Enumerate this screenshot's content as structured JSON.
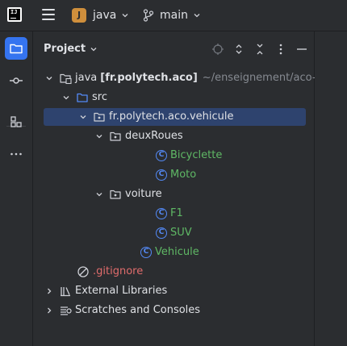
{
  "topbar": {
    "logo_text": "IJ",
    "project_badge": "J",
    "project_name": "java",
    "branch_name": "main",
    "colors": {
      "project_badge": "#cf8f3c"
    }
  },
  "stripe": {
    "icons": [
      "folder-icon",
      "commit-icon",
      "structure-icon",
      "more-icon"
    ],
    "accent": "#3574f0"
  },
  "panel": {
    "title": "Project",
    "tools": [
      "locate-icon",
      "expand-all-icon",
      "collapse-all-icon",
      "options-icon",
      "hide-icon"
    ]
  },
  "tree": [
    {
      "label": "java",
      "bold_suffix": "[fr.polytech.aco]",
      "path": "~/enseignement/aco-2",
      "icon": "module-folder-icon",
      "expanded": true
    },
    {
      "label": "src",
      "icon": "source-folder-icon",
      "expanded": true
    },
    {
      "label": "fr.polytech.aco.vehicule",
      "icon": "package-icon",
      "expanded": true,
      "selected": true
    },
    {
      "label": "deuxRoues",
      "icon": "package-icon",
      "expanded": true
    },
    {
      "label": "Bicyclette",
      "icon": "class-icon",
      "class_glyph": "C"
    },
    {
      "label": "Moto",
      "icon": "class-icon",
      "class_glyph": "C"
    },
    {
      "label": "voiture",
      "icon": "package-icon",
      "expanded": true
    },
    {
      "label": "F1",
      "icon": "class-icon",
      "class_glyph": "C"
    },
    {
      "label": "SUV",
      "icon": "class-icon",
      "class_glyph": "C"
    },
    {
      "label": "Vehicule",
      "icon": "class-icon",
      "class_glyph": "C"
    },
    {
      "label": ".gitignore",
      "icon": "ignored-file-icon"
    },
    {
      "label": "External Libraries",
      "icon": "libraries-icon",
      "expanded": false
    },
    {
      "label": "Scratches and Consoles",
      "icon": "scratches-icon",
      "expanded": false
    }
  ],
  "colors": {
    "selection": "#2e436e",
    "class_name": "#5fb865",
    "ignored_file": "#e06c6c",
    "class_icon": "#548af7"
  }
}
